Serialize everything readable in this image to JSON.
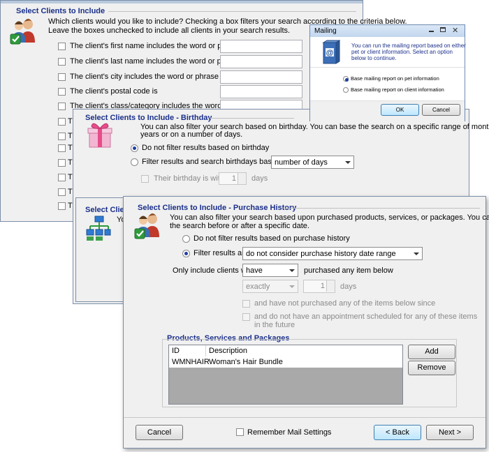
{
  "clients": {
    "title": "Select Clients to Include",
    "intro_line1": "Which clients would you like to include?  Checking a box filters your search according to the criteria below.",
    "intro_line2": "Leave the boxes unchecked to include all clients in your search results.",
    "criteria": [
      "The client's first name includes the word or phrase",
      "The client's last name includes the word or phrase",
      "The client's city includes the word or phrase",
      "The client's postal code is",
      "The client's class/category includes the word or phrase"
    ],
    "truncated_prefix": "T"
  },
  "birthday": {
    "title": "Select Clients to Include - Birthday",
    "intro_line1": "You can also filter your search based on birthday.  You can base the search on a specific range of months and",
    "intro_line2": "years or on a number of days.",
    "opt_none": "Do not filter results based on birthday",
    "opt_filter": "Filter results and search birthdays based on a",
    "basis_value": "number of days",
    "within_label": "Their birthday is within",
    "within_value": "1",
    "days_label": "days"
  },
  "behind": {
    "title_fragment": "Select Clients",
    "text_fragment": "Yo"
  },
  "mailing": {
    "title": "Mailing",
    "message_line1": "You can run the mailing report based on either",
    "message_line2": "pet or client information.  Select an option",
    "message_line3": "below to continue.",
    "opt_pet": "Base mailing report on pet information",
    "opt_client": "Base mailing report on client information",
    "ok_label": "OK",
    "cancel_label": "Cancel"
  },
  "purchase": {
    "title": "Select Clients to Include - Purchase History",
    "intro_line1": "You can also filter your search based upon purchased products, services, or packages.  You can base",
    "intro_line2": "the search before or after a specific date.",
    "opt_none": "Do not filter results based on purchase history",
    "opt_filter": "Filter results and",
    "range_value": "do not consider purchase history date range",
    "only_label": "Only include clients who",
    "have_value": "have",
    "purchased_label": "purchased any item below",
    "exactly_value": "exactly",
    "days_value": "1",
    "days_label": "days",
    "not_purchased_label": "and have not purchased any of the items below since",
    "no_appt_line1": "and do not have an appointment scheduled for any of these items",
    "no_appt_line2": "in the future",
    "products_title": "Products, Services and Packages",
    "columns": [
      "ID",
      "Description"
    ],
    "rows": [
      {
        "id": "WMNHAIR",
        "description": "Woman's Hair Bundle"
      }
    ],
    "add_label": "Add",
    "remove_label": "Remove"
  },
  "footer": {
    "cancel_label": "Cancel",
    "remember_label": "Remember Mail Settings",
    "back_label": "< Back",
    "next_label": "Next >"
  }
}
